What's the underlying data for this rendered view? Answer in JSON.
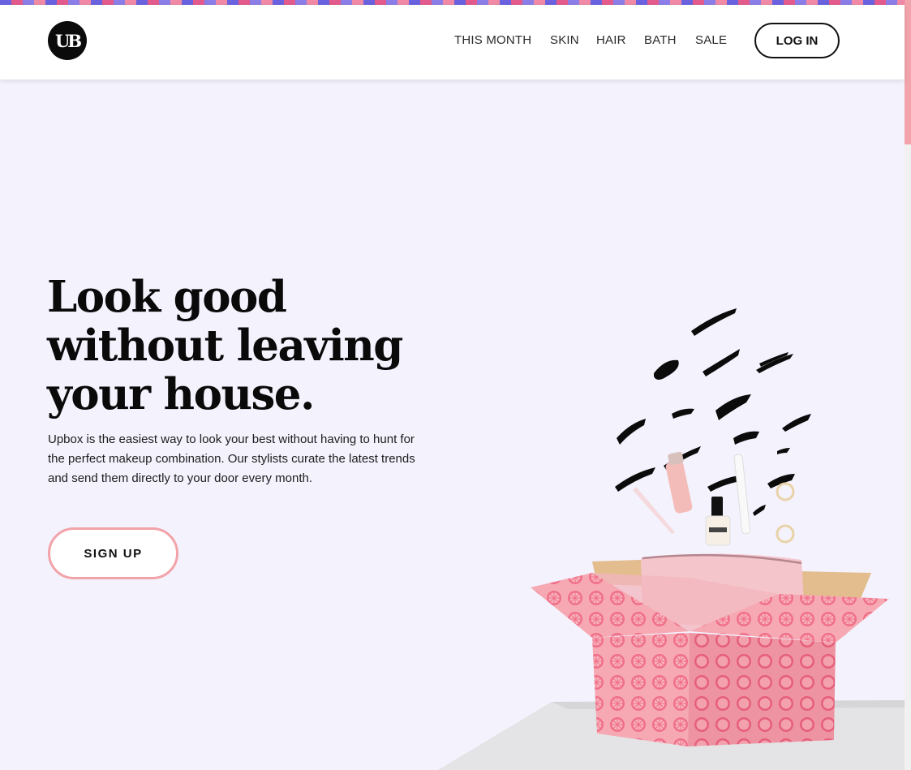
{
  "header": {
    "logo_text": "UB",
    "nav": [
      "THIS MONTH",
      "SKIN",
      "HAIR",
      "BATH",
      "SALE"
    ],
    "login_label": "LOG IN"
  },
  "hero": {
    "title_lines": [
      "Look good",
      "without leaving",
      "your house."
    ],
    "description": "Upbox is the easiest way to look your best without having to hunt for the perfect makeup combination. Our stylists curate the latest trends and send them directly to your door every month.",
    "signup_label": "SIGN UP"
  },
  "colors": {
    "background": "#f4f2fd",
    "accent_pink": "#f2a3a8",
    "box_pink": "#f6a2ad",
    "text": "#0a0a0a"
  },
  "illustration": {
    "icon": "gift-box-with-cosmetics-illustration"
  }
}
